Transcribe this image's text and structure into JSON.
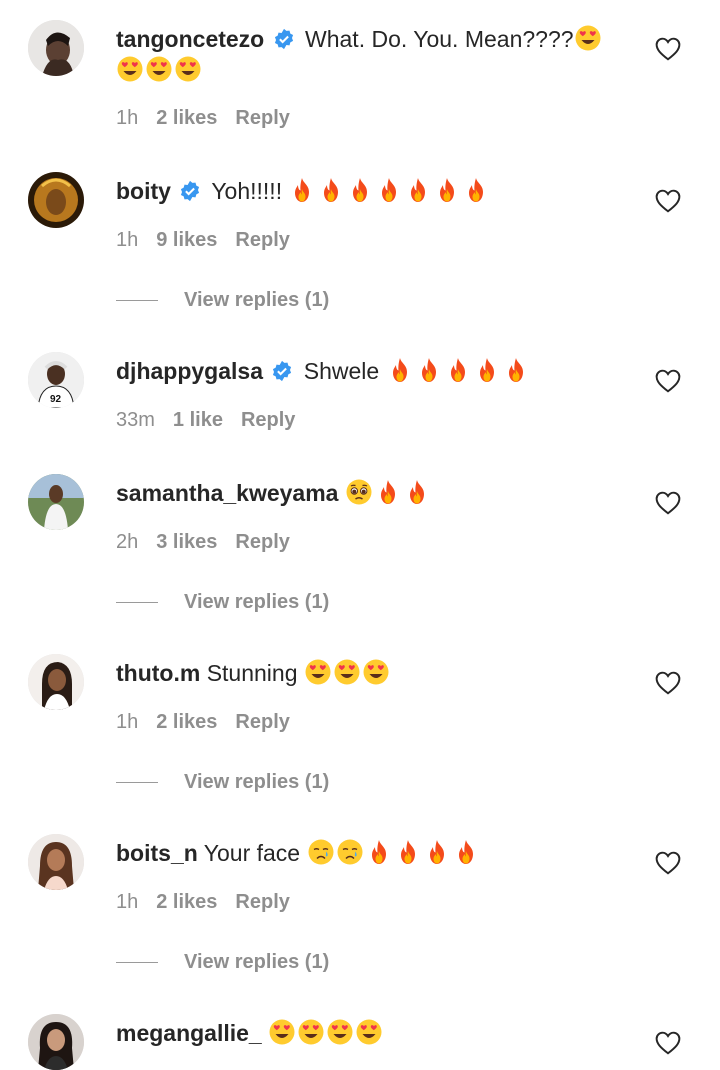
{
  "comments": [
    {
      "username": "tangoncetezo",
      "verified": true,
      "text": "What. Do. You. Mean????",
      "emojis_inline": [
        "heart-eyes"
      ],
      "emojis_next_line": [
        "heart-eyes",
        "heart-eyes",
        "heart-eyes"
      ],
      "time": "1h",
      "likes": "2 likes",
      "reply": "Reply",
      "view_replies": null
    },
    {
      "username": "boity",
      "verified": true,
      "text": "Yoh!!!!!",
      "emojis_inline": [
        "fire",
        "fire",
        "fire",
        "fire",
        "fire",
        "fire",
        "fire"
      ],
      "time": "1h",
      "likes": "9 likes",
      "reply": "Reply",
      "view_replies": "View replies (1)"
    },
    {
      "username": "djhappygalsa",
      "verified": true,
      "text": "Shwele",
      "emojis_inline": [
        "fire",
        "fire",
        "fire",
        "fire",
        "fire"
      ],
      "time": "33m",
      "likes": "1 like",
      "reply": "Reply",
      "view_replies": null
    },
    {
      "username": "samantha_kweyama",
      "verified": false,
      "text": "",
      "emojis_inline": [
        "pleading",
        "fire",
        "fire"
      ],
      "time": "2h",
      "likes": "3 likes",
      "reply": "Reply",
      "view_replies": "View replies (1)"
    },
    {
      "username": "thuto.m",
      "verified": false,
      "text": "Stunning",
      "emojis_inline": [
        "heart-eyes",
        "heart-eyes",
        "heart-eyes"
      ],
      "time": "1h",
      "likes": "2 likes",
      "reply": "Reply",
      "view_replies": "View replies (1)"
    },
    {
      "username": "boits_n",
      "verified": false,
      "text": "Your face",
      "emojis_inline": [
        "crying",
        "crying",
        "fire",
        "fire",
        "fire",
        "fire"
      ],
      "time": "1h",
      "likes": "2 likes",
      "reply": "Reply",
      "view_replies": "View replies (1)"
    },
    {
      "username": "megangallie_",
      "verified": false,
      "text": "",
      "emojis_inline": [
        "heart-eyes",
        "heart-eyes",
        "heart-eyes",
        "heart-eyes"
      ],
      "time": null,
      "likes": null,
      "reply": null,
      "view_replies": null
    }
  ],
  "colors": {
    "verified": "#3897f0",
    "meta": "#8e8e8e",
    "text": "#262626"
  }
}
